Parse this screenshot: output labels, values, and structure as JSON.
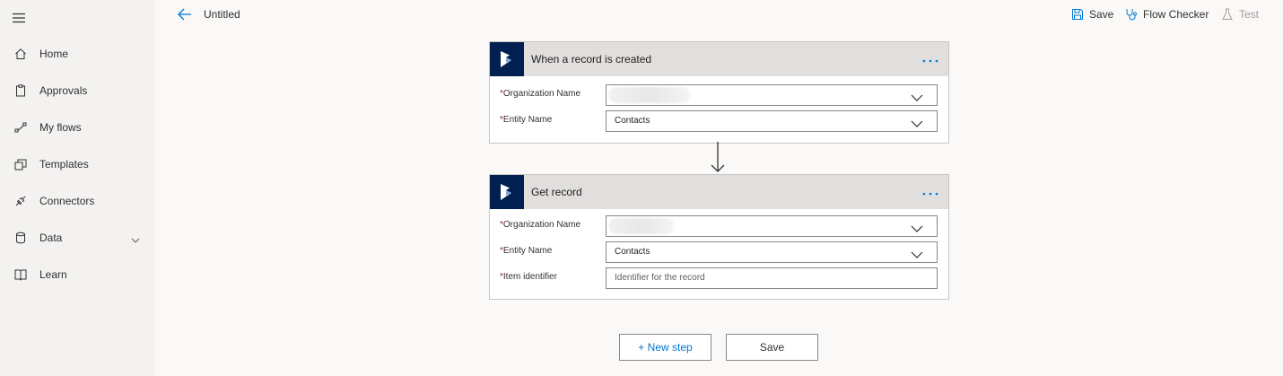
{
  "header": {
    "title": "Untitled",
    "actions": {
      "save": "Save",
      "flow_checker": "Flow Checker",
      "test": "Test"
    }
  },
  "sidebar": {
    "items": [
      {
        "label": "Home",
        "icon": "home-icon"
      },
      {
        "label": "Approvals",
        "icon": "clipboard-icon"
      },
      {
        "label": "My flows",
        "icon": "flow-icon"
      },
      {
        "label": "Templates",
        "icon": "templates-icon"
      },
      {
        "label": "Connectors",
        "icon": "connector-icon"
      },
      {
        "label": "Data",
        "icon": "database-icon",
        "expandable": true
      },
      {
        "label": "Learn",
        "icon": "book-icon"
      }
    ]
  },
  "cards": [
    {
      "title": "When a record is created",
      "fields": [
        {
          "label": "Organization Name",
          "required": true,
          "value": "",
          "type": "dropdown"
        },
        {
          "label": "Entity Name",
          "required": true,
          "value": "Contacts",
          "type": "dropdown"
        }
      ]
    },
    {
      "title": "Get record",
      "fields": [
        {
          "label": "Organization Name",
          "required": true,
          "value": "",
          "type": "dropdown"
        },
        {
          "label": "Entity Name",
          "required": true,
          "value": "Contacts",
          "type": "dropdown"
        },
        {
          "label": "Item identifier",
          "required": true,
          "placeholder": "Identifier for the record",
          "type": "text"
        }
      ]
    }
  ],
  "footer": {
    "new_step_plus": "+",
    "new_step_label": "New step",
    "save_label": "Save"
  },
  "colors": {
    "accent": "#0078d4",
    "dynamics_logo_bg": "#002050",
    "required": "#a4262c"
  }
}
